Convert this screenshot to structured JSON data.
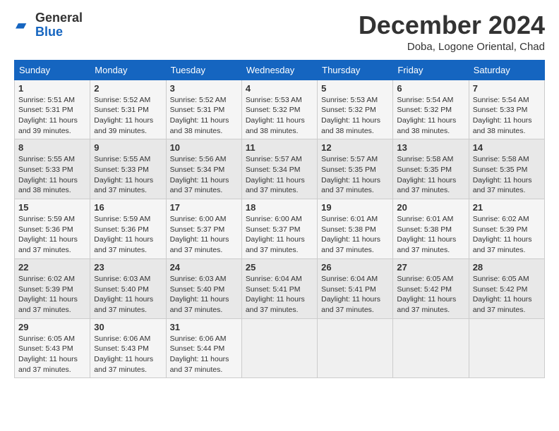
{
  "logo": {
    "general": "General",
    "blue": "Blue"
  },
  "header": {
    "month_title": "December 2024",
    "location": "Doba, Logone Oriental, Chad"
  },
  "weekdays": [
    "Sunday",
    "Monday",
    "Tuesday",
    "Wednesday",
    "Thursday",
    "Friday",
    "Saturday"
  ],
  "weeks": [
    [
      {
        "day": "1",
        "info": "Sunrise: 5:51 AM\nSunset: 5:31 PM\nDaylight: 11 hours\nand 39 minutes."
      },
      {
        "day": "2",
        "info": "Sunrise: 5:52 AM\nSunset: 5:31 PM\nDaylight: 11 hours\nand 39 minutes."
      },
      {
        "day": "3",
        "info": "Sunrise: 5:52 AM\nSunset: 5:31 PM\nDaylight: 11 hours\nand 38 minutes."
      },
      {
        "day": "4",
        "info": "Sunrise: 5:53 AM\nSunset: 5:32 PM\nDaylight: 11 hours\nand 38 minutes."
      },
      {
        "day": "5",
        "info": "Sunrise: 5:53 AM\nSunset: 5:32 PM\nDaylight: 11 hours\nand 38 minutes."
      },
      {
        "day": "6",
        "info": "Sunrise: 5:54 AM\nSunset: 5:32 PM\nDaylight: 11 hours\nand 38 minutes."
      },
      {
        "day": "7",
        "info": "Sunrise: 5:54 AM\nSunset: 5:33 PM\nDaylight: 11 hours\nand 38 minutes."
      }
    ],
    [
      {
        "day": "8",
        "info": "Sunrise: 5:55 AM\nSunset: 5:33 PM\nDaylight: 11 hours\nand 38 minutes."
      },
      {
        "day": "9",
        "info": "Sunrise: 5:55 AM\nSunset: 5:33 PM\nDaylight: 11 hours\nand 37 minutes."
      },
      {
        "day": "10",
        "info": "Sunrise: 5:56 AM\nSunset: 5:34 PM\nDaylight: 11 hours\nand 37 minutes."
      },
      {
        "day": "11",
        "info": "Sunrise: 5:57 AM\nSunset: 5:34 PM\nDaylight: 11 hours\nand 37 minutes."
      },
      {
        "day": "12",
        "info": "Sunrise: 5:57 AM\nSunset: 5:35 PM\nDaylight: 11 hours\nand 37 minutes."
      },
      {
        "day": "13",
        "info": "Sunrise: 5:58 AM\nSunset: 5:35 PM\nDaylight: 11 hours\nand 37 minutes."
      },
      {
        "day": "14",
        "info": "Sunrise: 5:58 AM\nSunset: 5:35 PM\nDaylight: 11 hours\nand 37 minutes."
      }
    ],
    [
      {
        "day": "15",
        "info": "Sunrise: 5:59 AM\nSunset: 5:36 PM\nDaylight: 11 hours\nand 37 minutes."
      },
      {
        "day": "16",
        "info": "Sunrise: 5:59 AM\nSunset: 5:36 PM\nDaylight: 11 hours\nand 37 minutes."
      },
      {
        "day": "17",
        "info": "Sunrise: 6:00 AM\nSunset: 5:37 PM\nDaylight: 11 hours\nand 37 minutes."
      },
      {
        "day": "18",
        "info": "Sunrise: 6:00 AM\nSunset: 5:37 PM\nDaylight: 11 hours\nand 37 minutes."
      },
      {
        "day": "19",
        "info": "Sunrise: 6:01 AM\nSunset: 5:38 PM\nDaylight: 11 hours\nand 37 minutes."
      },
      {
        "day": "20",
        "info": "Sunrise: 6:01 AM\nSunset: 5:38 PM\nDaylight: 11 hours\nand 37 minutes."
      },
      {
        "day": "21",
        "info": "Sunrise: 6:02 AM\nSunset: 5:39 PM\nDaylight: 11 hours\nand 37 minutes."
      }
    ],
    [
      {
        "day": "22",
        "info": "Sunrise: 6:02 AM\nSunset: 5:39 PM\nDaylight: 11 hours\nand 37 minutes."
      },
      {
        "day": "23",
        "info": "Sunrise: 6:03 AM\nSunset: 5:40 PM\nDaylight: 11 hours\nand 37 minutes."
      },
      {
        "day": "24",
        "info": "Sunrise: 6:03 AM\nSunset: 5:40 PM\nDaylight: 11 hours\nand 37 minutes."
      },
      {
        "day": "25",
        "info": "Sunrise: 6:04 AM\nSunset: 5:41 PM\nDaylight: 11 hours\nand 37 minutes."
      },
      {
        "day": "26",
        "info": "Sunrise: 6:04 AM\nSunset: 5:41 PM\nDaylight: 11 hours\nand 37 minutes."
      },
      {
        "day": "27",
        "info": "Sunrise: 6:05 AM\nSunset: 5:42 PM\nDaylight: 11 hours\nand 37 minutes."
      },
      {
        "day": "28",
        "info": "Sunrise: 6:05 AM\nSunset: 5:42 PM\nDaylight: 11 hours\nand 37 minutes."
      }
    ],
    [
      {
        "day": "29",
        "info": "Sunrise: 6:05 AM\nSunset: 5:43 PM\nDaylight: 11 hours\nand 37 minutes."
      },
      {
        "day": "30",
        "info": "Sunrise: 6:06 AM\nSunset: 5:43 PM\nDaylight: 11 hours\nand 37 minutes."
      },
      {
        "day": "31",
        "info": "Sunrise: 6:06 AM\nSunset: 5:44 PM\nDaylight: 11 hours\nand 37 minutes."
      },
      {
        "day": "",
        "info": ""
      },
      {
        "day": "",
        "info": ""
      },
      {
        "day": "",
        "info": ""
      },
      {
        "day": "",
        "info": ""
      }
    ]
  ]
}
